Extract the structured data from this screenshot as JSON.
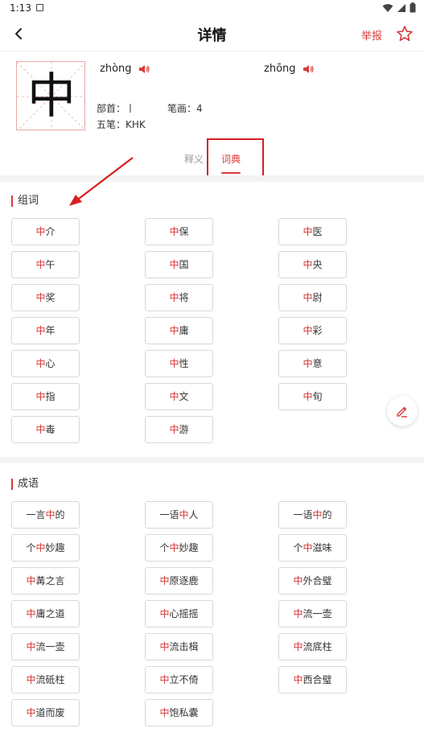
{
  "status": {
    "time": "1:13"
  },
  "header": {
    "title": "详情",
    "report": "举报"
  },
  "character": {
    "glyph": "中",
    "pinyin": [
      "zhòng",
      "zhōng"
    ],
    "radical": "部首：丨",
    "strokes": "笔画：4",
    "wubi": "五笔：KHK"
  },
  "tabs": [
    {
      "label": "释义",
      "active": false
    },
    {
      "label": "词典",
      "active": true
    }
  ],
  "sections": {
    "words": {
      "title": "组词",
      "items": [
        [
          "中",
          "介"
        ],
        [
          "中",
          "保"
        ],
        [
          "中",
          "医"
        ],
        [
          "中",
          "午"
        ],
        [
          "中",
          "国"
        ],
        [
          "中",
          "央"
        ],
        [
          "中",
          "奖"
        ],
        [
          "中",
          "将"
        ],
        [
          "中",
          "尉"
        ],
        [
          "中",
          "年"
        ],
        [
          "中",
          "庸"
        ],
        [
          "中",
          "彩"
        ],
        [
          "中",
          "心"
        ],
        [
          "中",
          "性"
        ],
        [
          "中",
          "意"
        ],
        [
          "中",
          "指"
        ],
        [
          "中",
          "文"
        ],
        [
          "中",
          "旬"
        ],
        [
          "中",
          "毒"
        ],
        [
          "中",
          "游"
        ]
      ]
    },
    "idioms": {
      "title": "成语",
      "items": [
        [
          "一言",
          "中",
          "的"
        ],
        [
          "一语",
          "中",
          "人"
        ],
        [
          "一语",
          "中",
          "的"
        ],
        [
          "个",
          "中",
          "妙趣"
        ],
        [
          "个",
          "中",
          "妙趣"
        ],
        [
          "个",
          "中",
          "滋味"
        ],
        [
          "",
          "中",
          "冓之言"
        ],
        [
          "",
          "中",
          "原逐鹿"
        ],
        [
          "",
          "中",
          "外合璧"
        ],
        [
          "",
          "中",
          "庸之道"
        ],
        [
          "",
          "中",
          "心摇摇"
        ],
        [
          "",
          "中",
          "流一壶"
        ],
        [
          "",
          "中",
          "流一壶"
        ],
        [
          "",
          "中",
          "流击楫"
        ],
        [
          "",
          "中",
          "流底柱"
        ],
        [
          "",
          "中",
          "流砥柱"
        ],
        [
          "",
          "中",
          "立不倚"
        ],
        [
          "",
          "中",
          "西合璧"
        ],
        [
          "",
          "中",
          "道而废"
        ],
        [
          "",
          "中",
          "饱私囊"
        ]
      ]
    }
  },
  "colors": {
    "accent": "#d83b3b",
    "annotation": "#d81e1e"
  },
  "icons": [
    "back-arrow-icon",
    "star-outline-icon",
    "speaker-icon",
    "edit-pencil-icon",
    "wifi-icon",
    "signal-icon",
    "battery-icon"
  ]
}
